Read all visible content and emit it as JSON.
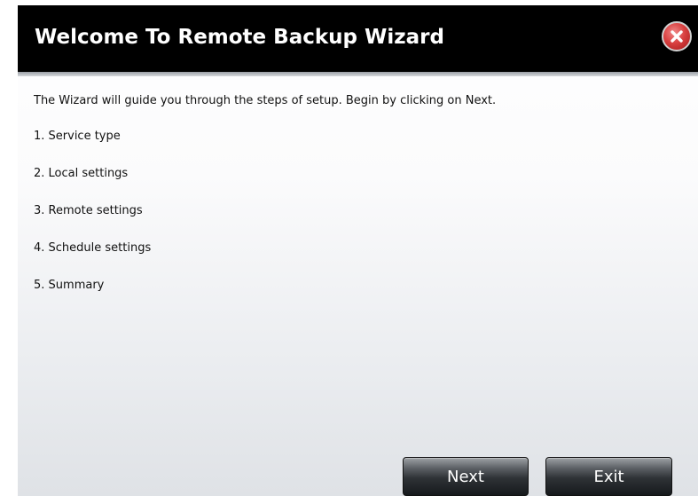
{
  "dialog": {
    "title": "Welcome To Remote Backup Wizard",
    "close_icon": "close-icon",
    "intro": "The Wizard will guide you through the steps of setup. Begin by clicking on Next.",
    "steps": [
      "1. Service type",
      "2. Local settings",
      "3. Remote settings",
      "4. Schedule settings",
      "5. Summary"
    ],
    "buttons": {
      "next": "Next",
      "exit": "Exit"
    },
    "colors": {
      "titlebar": "#000000",
      "close_button": "#d94141"
    }
  }
}
